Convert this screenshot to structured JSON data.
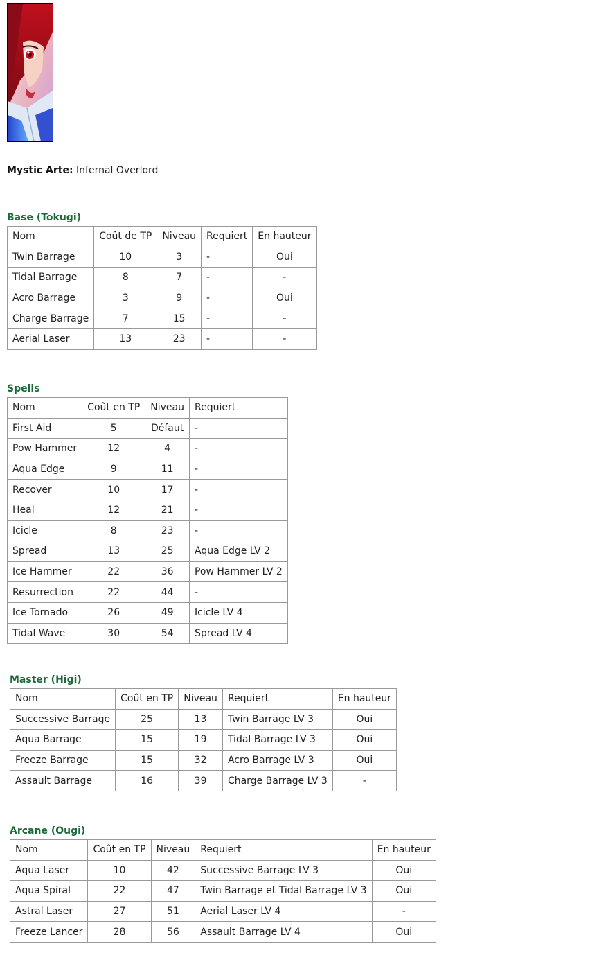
{
  "mystic_arte": {
    "label": "Mystic Arte:",
    "value": "Infernal Overlord"
  },
  "sections": [
    {
      "title": "Base (Tokugi)",
      "headers": [
        "Nom",
        "Coût de TP",
        "Niveau",
        "Requiert",
        "En hauteur"
      ],
      "rows": [
        [
          "Twin Barrage",
          "10",
          "3",
          "-",
          "Oui"
        ],
        [
          "Tidal Barrage",
          "8",
          "7",
          "-",
          "-"
        ],
        [
          "Acro Barrage",
          "3",
          "9",
          "-",
          "Oui"
        ],
        [
          "Charge Barrage",
          "7",
          "15",
          "-",
          "-"
        ],
        [
          "Aerial Laser",
          "13",
          "23",
          "-",
          "-"
        ]
      ]
    },
    {
      "title": "Spells",
      "headers": [
        "Nom",
        "Coût en TP",
        "Niveau",
        "Requiert"
      ],
      "rows": [
        [
          "First Aid",
          "5",
          "Défaut",
          "-"
        ],
        [
          "Pow Hammer",
          "12",
          "4",
          "-"
        ],
        [
          "Aqua Edge",
          "9",
          "11",
          "-"
        ],
        [
          "Recover",
          "10",
          "17",
          "-"
        ],
        [
          "Heal",
          "12",
          "21",
          "-"
        ],
        [
          "Icicle",
          "8",
          "23",
          "-"
        ],
        [
          "Spread",
          "13",
          "25",
          "Aqua Edge LV 2"
        ],
        [
          "Ice Hammer",
          "22",
          "36",
          "Pow Hammer LV 2"
        ],
        [
          "Resurrection",
          "22",
          "44",
          "-"
        ],
        [
          "Ice Tornado",
          "26",
          "49",
          "Icicle LV 4"
        ],
        [
          "Tidal Wave",
          "30",
          "54",
          "Spread LV 4"
        ]
      ]
    },
    {
      "title": "Master (Higi)",
      "headers": [
        "Nom",
        "Coût en TP",
        "Niveau",
        "Requiert",
        "En hauteur"
      ],
      "rows": [
        [
          "Successive Barrage",
          "25",
          "13",
          "Twin Barrage LV 3",
          "Oui"
        ],
        [
          "Aqua Barrage",
          "15",
          "19",
          "Tidal Barrage LV 3",
          "Oui"
        ],
        [
          "Freeze Barrage",
          "15",
          "32",
          "Acro Barrage LV 3",
          "Oui"
        ],
        [
          "Assault Barrage",
          "16",
          "39",
          "Charge Barrage LV 3",
          "-"
        ]
      ]
    },
    {
      "title": "Arcane (Ougi)",
      "headers": [
        "Nom",
        "Coût en TP",
        "Niveau",
        "Requiert",
        "En hauteur"
      ],
      "rows": [
        [
          "Aqua Laser",
          "10",
          "42",
          "Successive Barrage LV 3",
          "Oui"
        ],
        [
          "Aqua Spiral",
          "22",
          "47",
          "Twin Barrage et Tidal Barrage LV 3",
          "Oui"
        ],
        [
          "Astral Laser",
          "27",
          "51",
          "Aerial Laser LV 4",
          "-"
        ],
        [
          "Freeze Lancer",
          "28",
          "56",
          "Assault Barrage LV 4",
          "Oui"
        ]
      ]
    }
  ]
}
